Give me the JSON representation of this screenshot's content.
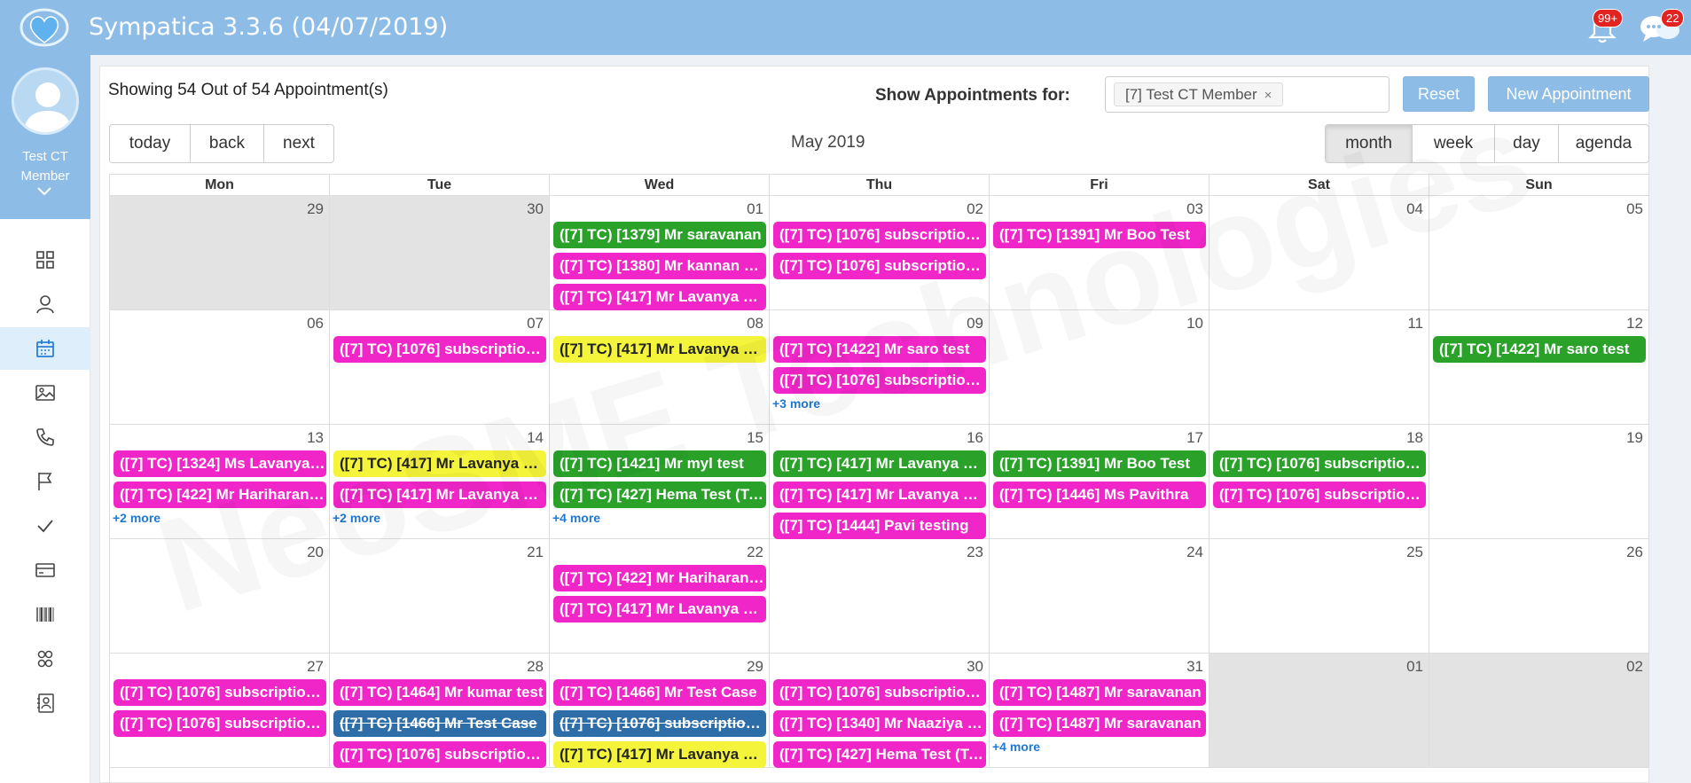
{
  "header": {
    "app_title": "Sympatica 3.3.6 (04/07/2019)",
    "notifications_badge": "99+",
    "messages_badge": "22"
  },
  "sidebar": {
    "user_name": "Test CT Member",
    "items": [
      {
        "icon": "dashboard-icon"
      },
      {
        "icon": "user-icon"
      },
      {
        "icon": "calendar-icon",
        "active": true
      },
      {
        "icon": "image-icon"
      },
      {
        "icon": "phone-icon"
      },
      {
        "icon": "flag-icon"
      },
      {
        "icon": "check-icon"
      },
      {
        "icon": "card-icon"
      },
      {
        "icon": "barcode-icon"
      },
      {
        "icon": "group-icon"
      },
      {
        "icon": "contact-icon"
      }
    ]
  },
  "toolbar": {
    "showing_text": "Showing 54 Out of 54 Appointment(s)",
    "show_for_label": "Show Appointments for:",
    "selected_member": "[7] Test CT Member",
    "chip_remove": "×",
    "reset_label": "Reset",
    "new_label": "New Appointment",
    "today_label": "today",
    "back_label": "back",
    "next_label": "next",
    "month_title": "May 2019",
    "views": [
      "month",
      "week",
      "day",
      "agenda"
    ],
    "active_view": "month"
  },
  "calendar": {
    "weekdays": [
      "Mon",
      "Tue",
      "Wed",
      "Thu",
      "Fri",
      "Sat",
      "Sun"
    ],
    "weeks": [
      [
        {
          "date": "29",
          "off": true,
          "events": []
        },
        {
          "date": "30",
          "off": true,
          "events": []
        },
        {
          "date": "01",
          "events": [
            {
              "text": "([7] TC) [1379] Mr saravanan",
              "color": "green"
            },
            {
              "text": "([7] TC) [1380] Mr kannan Test",
              "color": "pink"
            },
            {
              "text": "([7] TC) [417] Mr Lavanya Test",
              "color": "pink"
            }
          ]
        },
        {
          "date": "02",
          "events": [
            {
              "text": "([7] TC) [1076] subscription test",
              "color": "pink"
            },
            {
              "text": "([7] TC) [1076] subscription test",
              "color": "pink"
            }
          ]
        },
        {
          "date": "03",
          "events": [
            {
              "text": "([7] TC) [1391] Mr Boo Test",
              "color": "pink"
            }
          ]
        },
        {
          "date": "04",
          "events": []
        },
        {
          "date": "05",
          "events": []
        }
      ],
      [
        {
          "date": "06",
          "events": []
        },
        {
          "date": "07",
          "events": [
            {
              "text": "([7] TC) [1076] subscription test",
              "color": "pink"
            }
          ]
        },
        {
          "date": "08",
          "events": [
            {
              "text": "([7] TC) [417] Mr Lavanya Test",
              "color": "yellow"
            }
          ]
        },
        {
          "date": "09",
          "events": [
            {
              "text": "([7] TC) [1422] Mr saro test",
              "color": "pink"
            },
            {
              "text": "([7] TC) [1076] subscription test",
              "color": "pink"
            }
          ],
          "more": "+3 more"
        },
        {
          "date": "10",
          "events": []
        },
        {
          "date": "11",
          "events": []
        },
        {
          "date": "12",
          "events": [
            {
              "text": "([7] TC) [1422] Mr saro test",
              "color": "green"
            }
          ]
        }
      ],
      [
        {
          "date": "13",
          "events": [
            {
              "text": "([7] TC) [1324] Ms Lavanya Test",
              "color": "pink"
            },
            {
              "text": "([7] TC) [422] Mr Hariharan Test",
              "color": "pink"
            }
          ],
          "more": "+2 more"
        },
        {
          "date": "14",
          "events": [
            {
              "text": "([7] TC) [417] Mr Lavanya Test",
              "color": "yellow"
            },
            {
              "text": "([7] TC) [417] Mr Lavanya Test",
              "color": "pink"
            }
          ],
          "more": "+2 more"
        },
        {
          "date": "15",
          "events": [
            {
              "text": "([7] TC) [1421] Mr myl test",
              "color": "green"
            },
            {
              "text": "([7] TC) [427] Hema Test (Test)",
              "color": "green"
            }
          ],
          "more": "+4 more"
        },
        {
          "date": "16",
          "events": [
            {
              "text": "([7] TC) [417] Mr Lavanya Test",
              "color": "green"
            },
            {
              "text": "([7] TC) [417] Mr Lavanya Test",
              "color": "pink"
            },
            {
              "text": "([7] TC) [1444] Pavi testing",
              "color": "pink"
            }
          ]
        },
        {
          "date": "17",
          "events": [
            {
              "text": "([7] TC) [1391] Mr Boo Test",
              "color": "green"
            },
            {
              "text": "([7] TC) [1446] Ms Pavithra",
              "color": "pink"
            }
          ]
        },
        {
          "date": "18",
          "events": [
            {
              "text": "([7] TC) [1076] subscription test",
              "color": "green"
            },
            {
              "text": "([7] TC) [1076] subscription test",
              "color": "pink"
            }
          ]
        },
        {
          "date": "19",
          "events": []
        }
      ],
      [
        {
          "date": "20",
          "events": []
        },
        {
          "date": "21",
          "events": []
        },
        {
          "date": "22",
          "events": [
            {
              "text": "([7] TC) [422] Mr Hariharan Test",
              "color": "pink"
            },
            {
              "text": "([7] TC) [417] Mr Lavanya Test",
              "color": "pink"
            }
          ]
        },
        {
          "date": "23",
          "events": []
        },
        {
          "date": "24",
          "events": []
        },
        {
          "date": "25",
          "events": []
        },
        {
          "date": "26",
          "events": []
        }
      ],
      [
        {
          "date": "27",
          "events": [
            {
              "text": "([7] TC) [1076] subscription test",
              "color": "pink"
            },
            {
              "text": "([7] TC) [1076] subscription test",
              "color": "pink"
            }
          ]
        },
        {
          "date": "28",
          "events": [
            {
              "text": "([7] TC) [1464] Mr kumar test",
              "color": "pink"
            },
            {
              "text": "([7] TC) [1466] Mr Test Case",
              "color": "blue"
            },
            {
              "text": "([7] TC) [1076] subscription test",
              "color": "pink"
            }
          ]
        },
        {
          "date": "29",
          "events": [
            {
              "text": "([7] TC) [1466] Mr Test Case",
              "color": "pink"
            },
            {
              "text": "([7] TC) [1076] subscription test",
              "color": "blue"
            },
            {
              "text": "([7] TC) [417] Mr Lavanya Test",
              "color": "yellow"
            }
          ]
        },
        {
          "date": "30",
          "events": [
            {
              "text": "([7] TC) [1076] subscription test",
              "color": "pink"
            },
            {
              "text": "([7] TC) [1340] Mr Naaziya Test",
              "color": "pink"
            },
            {
              "text": "([7] TC) [427] Hema Test (Test)",
              "color": "pink"
            }
          ]
        },
        {
          "date": "31",
          "events": [
            {
              "text": "([7] TC) [1487] Mr saravanan",
              "color": "pink"
            },
            {
              "text": "([7] TC) [1487] Mr saravanan",
              "color": "pink"
            }
          ],
          "more": "+4 more"
        },
        {
          "date": "01",
          "off": true,
          "events": []
        },
        {
          "date": "02",
          "off": true,
          "events": []
        }
      ]
    ]
  },
  "watermark": "NeoSME Technologies",
  "colors": {
    "header": "#8dbde6",
    "event_green": "#2aa22a",
    "event_pink": "#f026c8",
    "event_yellow": "#f4f43a",
    "event_blue": "#2e6ea8",
    "link": "#1f78d1"
  }
}
